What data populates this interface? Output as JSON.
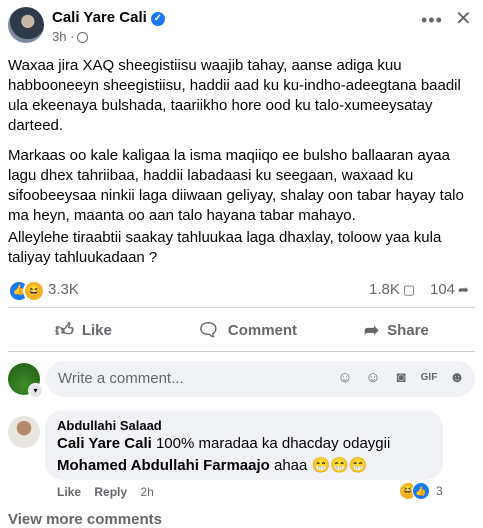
{
  "post": {
    "author": "Cali Yare Cali",
    "time": "3h",
    "paragraphs": [
      "Waxaa jira XAQ sheegistiisu waajib tahay, aanse adiga kuu habbooneeyn sheegistiisu, haddii aad ku ku-indho-adeegtana baadil ula ekeenaya bulshada, taariikho hore ood ku talo-xumeeysatay darteed.",
      "Markaas oo kale kaligaa la isma maqiiqo ee bulsho ballaaran ayaa lagu dhex tahriibaa, haddii labadaasi ku seegaan, waxaad ku sifoobeeysaa ninkii laga diiwaan geliyay, shalay oon tabar hayay talo ma heyn, maanta oo aan talo hayana tabar mahayo.",
      "Alleylehe tiraabtii saakay tahluukaa laga dhaxlay, toloow yaa kula taliyay tahluukadaan ?"
    ]
  },
  "stats": {
    "reactions": "3.3K",
    "comments": "1.8K",
    "shares": "104"
  },
  "actions": {
    "like": "Like",
    "comment": "Comment",
    "share": "Share"
  },
  "composer": {
    "placeholder": "Write a comment..."
  },
  "comment": {
    "author": "Abdullahi Salaad",
    "mention1": "Cali Yare Cali",
    "text1": " 100% maradaa ka dhacday odaygii",
    "mention2": "Mohamed Abdullahi Farmaajo",
    "text2": " ahaa 😁😁😁",
    "like": "Like",
    "reply": "Reply",
    "time": "2h",
    "reactions": "3"
  },
  "view_more": "View more comments",
  "icons": [
    "verified-icon",
    "globe-icon",
    "more-icon",
    "close-icon",
    "like-icon",
    "haha-icon",
    "comment-icon",
    "share-icon",
    "emoji-icon",
    "camera-icon",
    "gif-icon",
    "sticker-icon"
  ]
}
